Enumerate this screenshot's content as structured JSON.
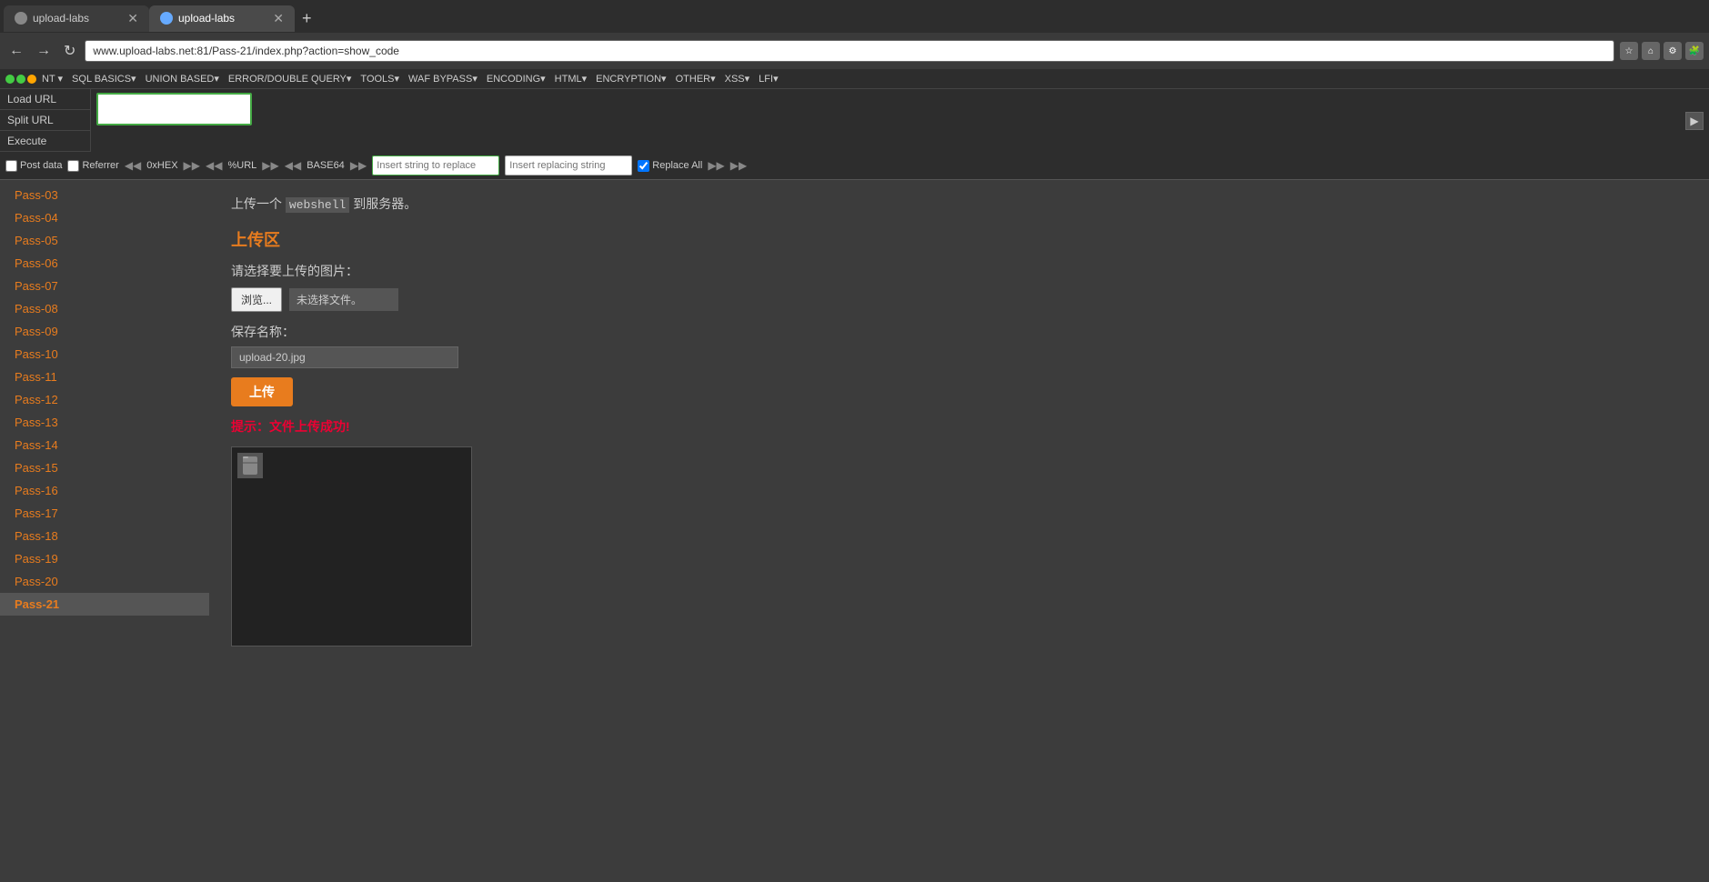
{
  "browser": {
    "tabs": [
      {
        "id": "tab1",
        "label": "upload-labs",
        "active": false
      },
      {
        "id": "tab2",
        "label": "upload-labs",
        "active": true
      }
    ],
    "url": "www.upload-labs.net:81/Pass-21/index.php?action=show_code"
  },
  "hackbar": {
    "menu_items": [
      {
        "label": "NT",
        "type": "dropdown"
      },
      {
        "label": "SQL BASICS▾"
      },
      {
        "label": "UNION BASED▾"
      },
      {
        "label": "ERROR/DOUBLE QUERY▾"
      },
      {
        "label": "TOOLS▾"
      },
      {
        "label": "WAF BYPASS▾"
      },
      {
        "label": "ENCODING▾"
      },
      {
        "label": "HTML▾"
      },
      {
        "label": "ENCRYPTION▾"
      },
      {
        "label": "OTHER▾"
      },
      {
        "label": "XSS▾"
      },
      {
        "label": "LFI▾"
      }
    ],
    "left_buttons": [
      {
        "label": "Load URL"
      },
      {
        "label": "Split URL"
      },
      {
        "label": "Execute"
      }
    ],
    "url_value": "",
    "options": {
      "post_data": {
        "label": "Post data",
        "checked": false
      },
      "referrer": {
        "label": "Referrer",
        "checked": false
      },
      "hex": {
        "label": "0xHEX",
        "checked": false
      },
      "url_encode": {
        "label": "%URL",
        "checked": false
      },
      "base64": {
        "label": "BASE64",
        "checked": false
      },
      "replace_string_placeholder": "Insert string to replace",
      "replacing_string_placeholder": "Insert replacing string",
      "replace_all": {
        "label": "Replace All",
        "checked": true
      }
    }
  },
  "sidebar": {
    "items": [
      {
        "label": "Pass-03"
      },
      {
        "label": "Pass-04"
      },
      {
        "label": "Pass-05"
      },
      {
        "label": "Pass-06"
      },
      {
        "label": "Pass-07"
      },
      {
        "label": "Pass-08"
      },
      {
        "label": "Pass-09"
      },
      {
        "label": "Pass-10"
      },
      {
        "label": "Pass-11"
      },
      {
        "label": "Pass-12"
      },
      {
        "label": "Pass-13"
      },
      {
        "label": "Pass-14"
      },
      {
        "label": "Pass-15"
      },
      {
        "label": "Pass-16"
      },
      {
        "label": "Pass-17"
      },
      {
        "label": "Pass-18"
      },
      {
        "label": "Pass-19"
      },
      {
        "label": "Pass-20"
      },
      {
        "label": "Pass-21",
        "active": true
      }
    ]
  },
  "content": {
    "description_prefix": "上传一个 ",
    "description_code": "webshell",
    "description_suffix": " 到服务器。",
    "section_title": "上传区",
    "file_label": "请选择要上传的图片：",
    "browse_button": "浏览...",
    "no_file_text": "未选择文件。",
    "save_label": "保存名称：",
    "save_input_value": "upload-20.jpg",
    "upload_button": "上传",
    "success_message": "提示：文件上传成功!"
  }
}
